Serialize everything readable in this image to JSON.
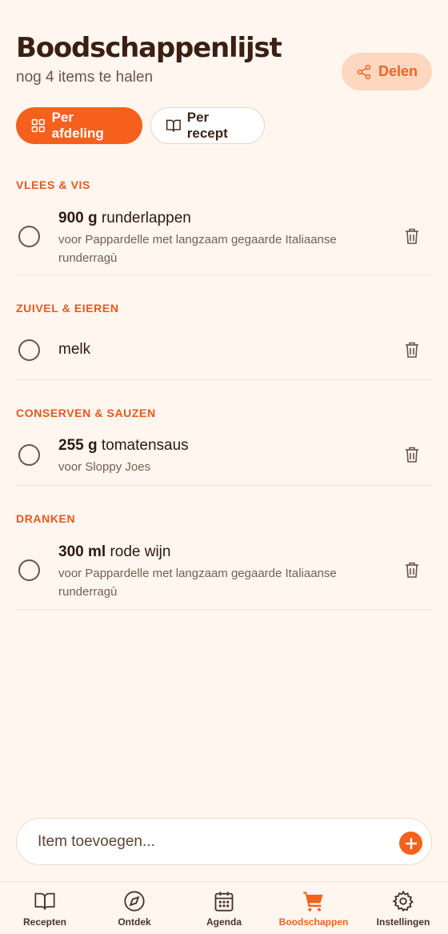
{
  "header": {
    "title": "Boodschappenlijst",
    "subtitle": "nog 4 items te halen",
    "share_label": "Delen"
  },
  "view_toggle": {
    "by_department": "Per afdeling",
    "by_recipe": "Per recept",
    "selected": "Per afdeling"
  },
  "sections": [
    {
      "title": "VLEES & VIS",
      "items": [
        {
          "qty": "900 g",
          "name": "runderlappen",
          "note": "voor Pappardelle met langzaam gegaarde Italiaanse runderragù"
        }
      ]
    },
    {
      "title": "ZUIVEL & EIEREN",
      "items": [
        {
          "qty": "",
          "name": "melk",
          "note": ""
        }
      ]
    },
    {
      "title": "CONSERVEN & SAUZEN",
      "items": [
        {
          "qty": "255 g",
          "name": "tomatensaus",
          "note": "voor Sloppy Joes"
        }
      ]
    },
    {
      "title": "DRANKEN",
      "items": [
        {
          "qty": "300 ml",
          "name": "rode wijn",
          "note": "voor Pappardelle met langzaam gegaarde Italiaanse runderragù"
        }
      ]
    }
  ],
  "add_item": {
    "placeholder": "Item toevoegen..."
  },
  "nav": {
    "items": [
      {
        "label": "Recepten",
        "icon": "book-icon"
      },
      {
        "label": "Ontdek",
        "icon": "compass-icon"
      },
      {
        "label": "Agenda",
        "icon": "calendar-icon"
      },
      {
        "label": "Boodschappen",
        "icon": "cart-icon"
      },
      {
        "label": "Instellingen",
        "icon": "gear-icon"
      }
    ],
    "active": "Boodschappen"
  },
  "colors": {
    "accent": "#f5611c",
    "background": "#fff6f0",
    "share_bg": "#fdd7bf",
    "section_title": "#e8581a"
  }
}
